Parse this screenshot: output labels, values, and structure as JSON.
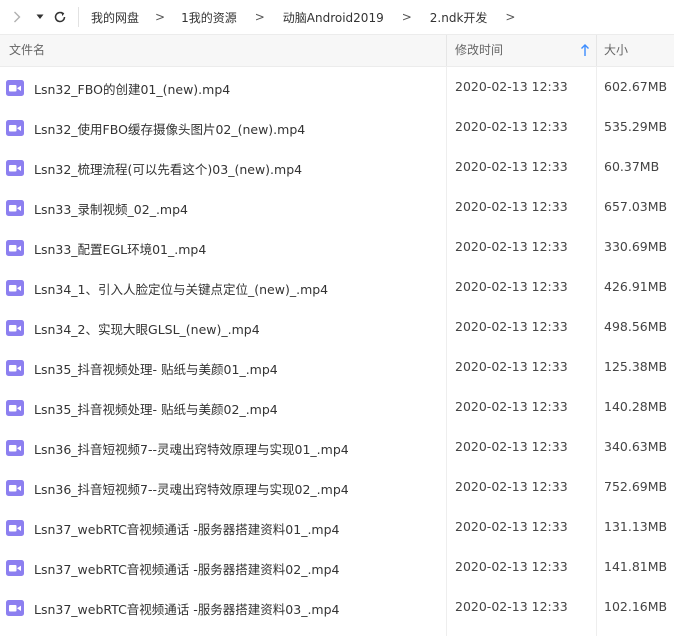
{
  "nav": {
    "back_icon": "chevron-right-icon",
    "menu_icon": "caret-down-icon",
    "refresh_icon": "refresh-icon"
  },
  "breadcrumb": [
    "我的网盘",
    "1我的资源",
    "动脑Android2019",
    "2.ndk开发"
  ],
  "columns": {
    "name": "文件名",
    "modified": "修改时间",
    "size": "大小"
  },
  "colors": {
    "video_icon": "#8c7ff0",
    "sort_arrow": "#3b8cff"
  },
  "files": [
    {
      "name": "Lsn32_FBO的创建01_(new).mp4",
      "modified": "2020-02-13 12:33",
      "size": "602.67MB"
    },
    {
      "name": "Lsn32_使用FBO缓存摄像头图片02_(new).mp4",
      "modified": "2020-02-13 12:33",
      "size": "535.29MB"
    },
    {
      "name": "Lsn32_梳理流程(可以先看这个)03_(new).mp4",
      "modified": "2020-02-13 12:33",
      "size": "60.37MB"
    },
    {
      "name": "Lsn33_录制视频_02_.mp4",
      "modified": "2020-02-13 12:33",
      "size": "657.03MB"
    },
    {
      "name": "Lsn33_配置EGL环境01_.mp4",
      "modified": "2020-02-13 12:33",
      "size": "330.69MB"
    },
    {
      "name": "Lsn34_1、引入人脸定位与关键点定位_(new)_.mp4",
      "modified": "2020-02-13 12:33",
      "size": "426.91MB"
    },
    {
      "name": "Lsn34_2、实现大眼GLSL_(new)_.mp4",
      "modified": "2020-02-13 12:33",
      "size": "498.56MB"
    },
    {
      "name": "Lsn35_抖音视频处理- 贴纸与美颜01_.mp4",
      "modified": "2020-02-13 12:33",
      "size": "125.38MB"
    },
    {
      "name": "Lsn35_抖音视频处理- 贴纸与美颜02_.mp4",
      "modified": "2020-02-13 12:33",
      "size": "140.28MB"
    },
    {
      "name": "Lsn36_抖音短视频7--灵魂出窍特效原理与实现01_.mp4",
      "modified": "2020-02-13 12:33",
      "size": "340.63MB"
    },
    {
      "name": "Lsn36_抖音短视频7--灵魂出窍特效原理与实现02_.mp4",
      "modified": "2020-02-13 12:33",
      "size": "752.69MB"
    },
    {
      "name": "Lsn37_webRTC音视频通话 -服务器搭建资料01_.mp4",
      "modified": "2020-02-13 12:33",
      "size": "131.13MB"
    },
    {
      "name": "Lsn37_webRTC音视频通话 -服务器搭建资料02_.mp4",
      "modified": "2020-02-13 12:33",
      "size": "141.81MB"
    },
    {
      "name": "Lsn37_webRTC音视频通话 -服务器搭建资料03_.mp4",
      "modified": "2020-02-13 12:33",
      "size": "102.16MB"
    }
  ]
}
